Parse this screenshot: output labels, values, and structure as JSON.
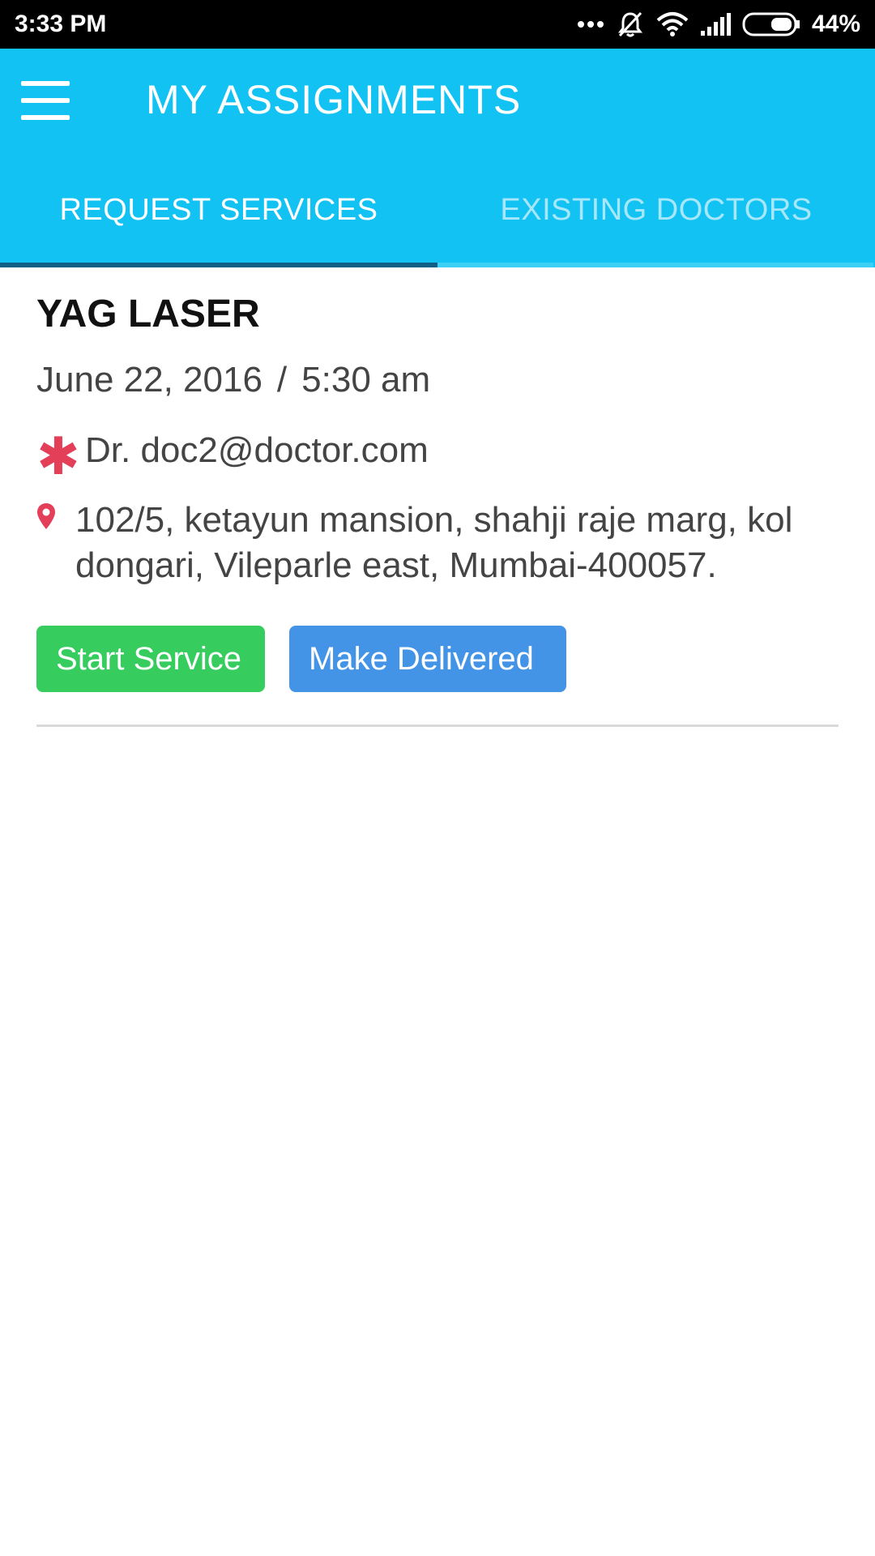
{
  "status_bar": {
    "time": "3:33 PM",
    "battery": "44%",
    "icons": [
      "more-dots-icon",
      "silent-bell-icon",
      "wifi-icon",
      "signal-icon",
      "battery-icon"
    ]
  },
  "app_bar": {
    "title": "MY ASSIGNMENTS",
    "menu_icon": "hamburger-menu-icon",
    "color": "#12c2f2"
  },
  "tabs": [
    {
      "label": "REQUEST SERVICES",
      "active": true
    },
    {
      "label": "EXISTING DOCTORS",
      "active": false
    }
  ],
  "assignment": {
    "service": "YAG LASER",
    "date": "June 22, 2016",
    "separator": "/",
    "time": "5:30 am",
    "doctor_icon": "asterisk-icon",
    "doctor": "Dr. doc2@doctor.com",
    "address_icon": "location-pin-icon",
    "address": "102/5, ketayun mansion, shahji raje marg, kol dongari, Vileparle east, Mumbai-400057."
  },
  "actions": {
    "start_label": "Start Service",
    "start_color": "#36cc5e",
    "deliver_label": "Make Delivered",
    "deliver_color": "#4393e6"
  }
}
